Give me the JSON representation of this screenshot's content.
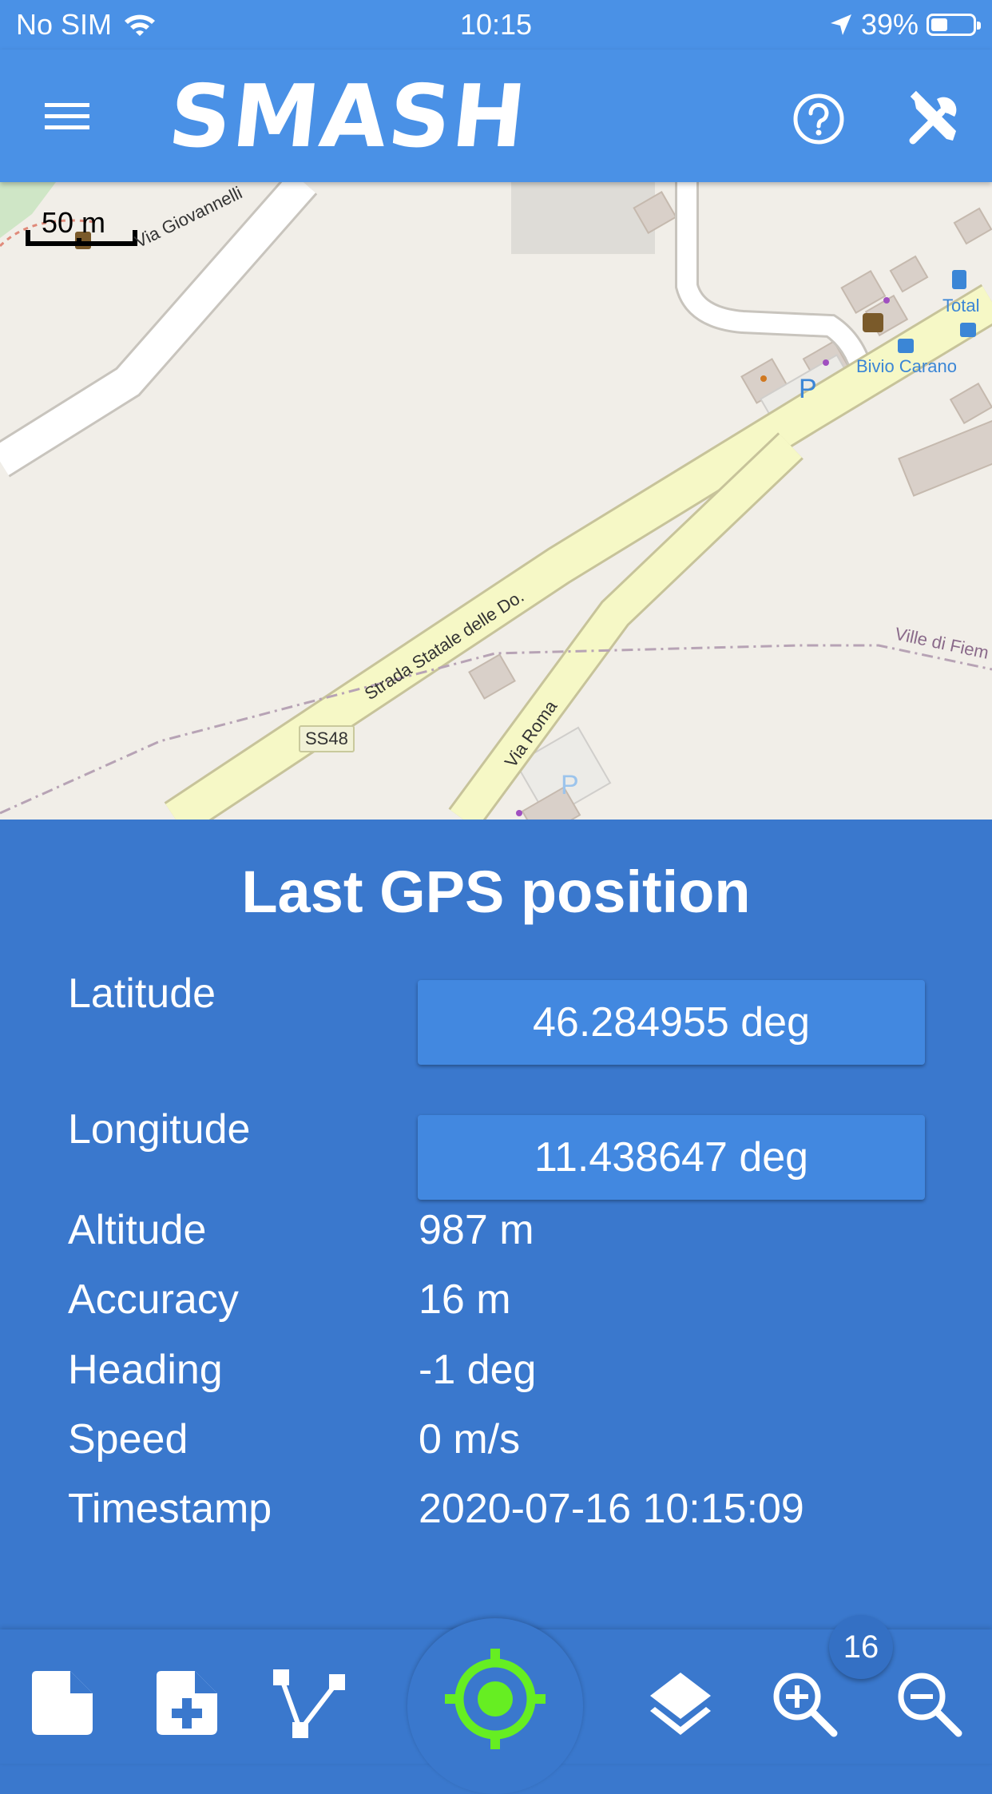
{
  "status_bar": {
    "carrier": "No SIM",
    "time": "10:15",
    "battery": "39%",
    "battery_level": 0.39
  },
  "app_bar": {
    "title": "SMASH",
    "menu_icon": "hamburger-menu-icon",
    "help_icon": "help-circle-icon",
    "tools_icon": "tools-icon"
  },
  "map": {
    "scale_label": "50 m",
    "labels": {
      "via_giovannelli": "Via Giovannelli",
      "strada_statale": "Strada Statale delle Do.",
      "via_roma": "Via Roma",
      "ss48": "SS48",
      "ville_di_fiemme": "Ville di Fiem",
      "total": "Total",
      "bivio_carano": "Bivio Carano",
      "parking": "P"
    }
  },
  "panel": {
    "heading": "Last GPS position",
    "latitude": {
      "label": "Latitude",
      "value": "46.284955 deg"
    },
    "longitude": {
      "label": "Longitude",
      "value": "11.438647 deg"
    },
    "altitude": {
      "label": "Altitude",
      "value": "987 m"
    },
    "accuracy": {
      "label": "Accuracy",
      "value": "16 m"
    },
    "heading_row": {
      "label": "Heading",
      "value": "-1 deg"
    },
    "speed": {
      "label": "Speed",
      "value": "0 m/s"
    },
    "timestamp": {
      "label": "Timestamp",
      "value": "2020-07-16 10:15:09"
    }
  },
  "bottom_bar": {
    "zoom_level": "16",
    "center_color": "#66ee22",
    "icons": [
      "note-icon",
      "add-note-icon",
      "polyline-icon",
      "gps-center-icon",
      "layers-icon",
      "zoom-in-icon",
      "zoom-out-icon"
    ]
  }
}
